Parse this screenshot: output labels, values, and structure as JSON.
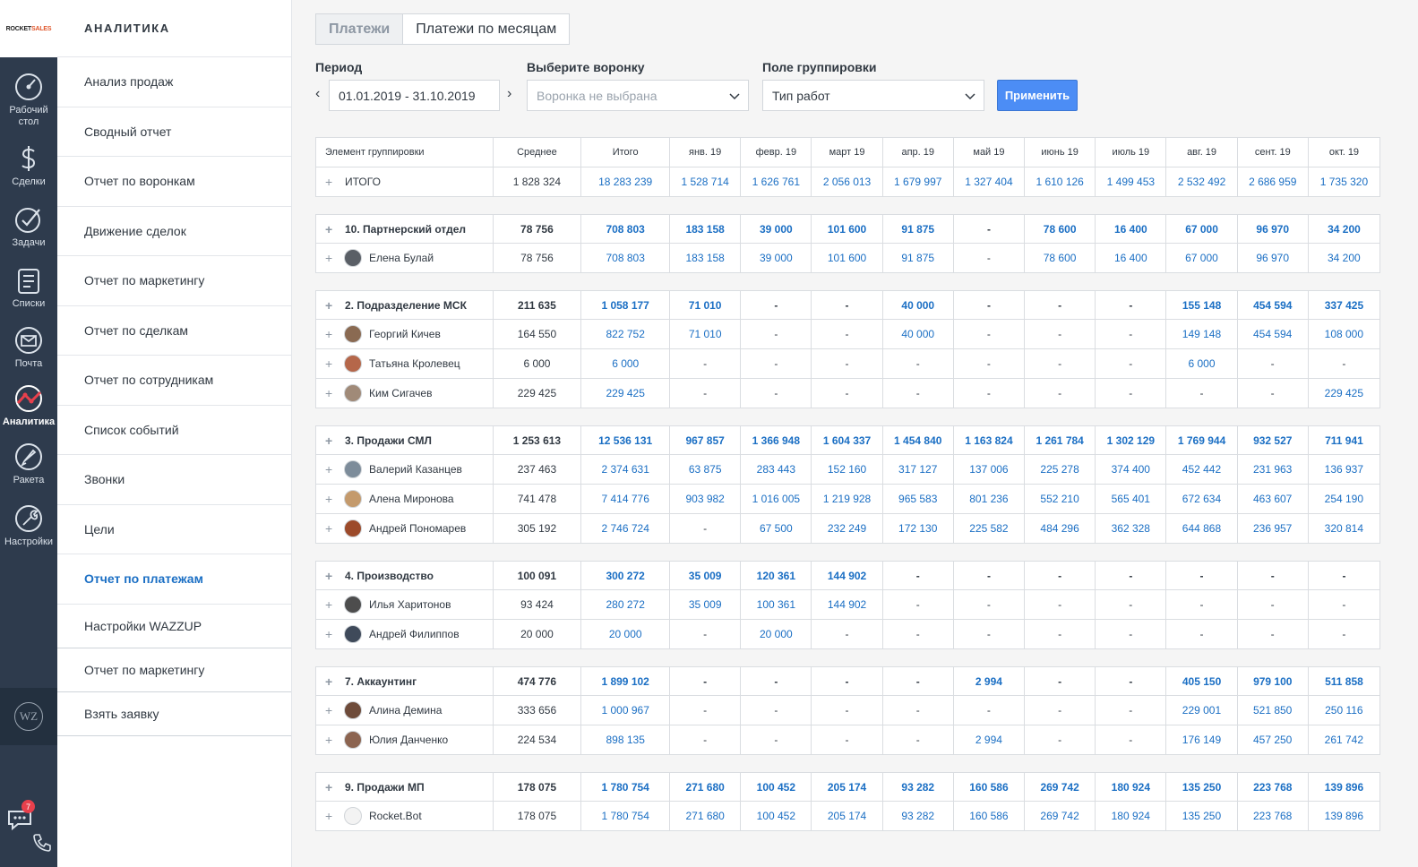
{
  "logo": {
    "part1": "ROCKET",
    "part2": "SALES"
  },
  "nav": [
    {
      "label": "Рабочий стол",
      "icon": "dashboard-icon"
    },
    {
      "label": "Сделки",
      "icon": "dollar-icon"
    },
    {
      "label": "Задачи",
      "icon": "check-icon"
    },
    {
      "label": "Списки",
      "icon": "list-icon"
    },
    {
      "label": "Почта",
      "icon": "mail-icon"
    },
    {
      "label": "Аналитика",
      "icon": "analytics-icon",
      "active": true
    },
    {
      "label": "Ракета",
      "icon": "rocket-icon"
    },
    {
      "label": "Настройки",
      "icon": "wrench-icon"
    }
  ],
  "wazzup_icon_text": "WZ",
  "chat_badge": "7",
  "submenu": {
    "title": "АНАЛИТИКА",
    "items": [
      "Анализ продаж",
      "Сводный отчет",
      "Отчет по воронкам",
      "Движение сделок",
      "Отчет по маркетингу",
      "Отчет по сделкам",
      "Отчет по сотрудникам",
      "Список событий",
      "Звонки",
      "Цели",
      "Отчет по платежам",
      "Настройки WAZZUP"
    ],
    "extra_items": [
      "Отчет по маркетингу",
      "Взять заявку"
    ]
  },
  "tabs": {
    "payments": "Платежи",
    "by_month": "Платежи по месяцам"
  },
  "filters": {
    "period_label": "Период",
    "period_value": "01.01.2019 - 31.10.2019",
    "prev_arrow": "‹",
    "next_arrow": "›",
    "funnel_label": "Выберите воронку",
    "funnel_placeholder": "Воронка не выбрана",
    "group_label": "Поле группировки",
    "group_value": "Тип работ",
    "apply": "Применить"
  },
  "table": {
    "headers": [
      "Элемент группировки",
      "Среднее",
      "Итого",
      "янв. 19",
      "февр. 19",
      "март 19",
      "апр. 19",
      "май 19",
      "июнь 19",
      "июль 19",
      "авг. 19",
      "сент. 19",
      "окт. 19"
    ],
    "total": {
      "name": "ИТОГО",
      "avg": "1 828 324",
      "values": [
        "18 283 239",
        "1 528 714",
        "1 626 761",
        "2 056 013",
        "1 679 997",
        "1 327 404",
        "1 610 126",
        "1 499 453",
        "2 532 492",
        "2 686 959",
        "1 735 320"
      ]
    },
    "groups": [
      {
        "name": "10. Партнерский отдел",
        "avg": "78 756",
        "values": [
          "708 803",
          "183 158",
          "39 000",
          "101 600",
          "91 875",
          "-",
          "78 600",
          "16 400",
          "67 000",
          "96 970",
          "34 200"
        ],
        "people": [
          {
            "name": "Елена Булай",
            "avg": "78 756",
            "values": [
              "708 803",
              "183 158",
              "39 000",
              "101 600",
              "91 875",
              "-",
              "78 600",
              "16 400",
              "67 000",
              "96 970",
              "34 200"
            ],
            "avatar": "#5a5f66"
          }
        ]
      },
      {
        "name": "2. Подразделение МСК",
        "avg": "211 635",
        "values": [
          "1 058 177",
          "71 010",
          "-",
          "-",
          "40 000",
          "-",
          "-",
          "-",
          "155 148",
          "454 594",
          "337 425"
        ],
        "people": [
          {
            "name": "Георгий Кичев",
            "avg": "164 550",
            "values": [
              "822 752",
              "71 010",
              "-",
              "-",
              "40 000",
              "-",
              "-",
              "-",
              "149 148",
              "454 594",
              "108 000"
            ],
            "avatar": "#8a6a52"
          },
          {
            "name": "Татьяна Кролевец",
            "avg": "6 000",
            "values": [
              "6 000",
              "-",
              "-",
              "-",
              "-",
              "-",
              "-",
              "-",
              "6 000",
              "-",
              "-"
            ],
            "avatar": "#b5674a"
          },
          {
            "name": "Ким Сигачев",
            "avg": "229 425",
            "values": [
              "229 425",
              "-",
              "-",
              "-",
              "-",
              "-",
              "-",
              "-",
              "-",
              "-",
              "229 425"
            ],
            "avatar": "#a08a78"
          }
        ]
      },
      {
        "name": "3. Продажи СМЛ",
        "avg": "1 253 613",
        "values": [
          "12 536 131",
          "967 857",
          "1 366 948",
          "1 604 337",
          "1 454 840",
          "1 163 824",
          "1 261 784",
          "1 302 129",
          "1 769 944",
          "932 527",
          "711 941"
        ],
        "people": [
          {
            "name": "Валерий Казанцев",
            "avg": "237 463",
            "values": [
              "2 374 631",
              "63 875",
              "283 443",
              "152 160",
              "317 127",
              "137 006",
              "225 278",
              "374 400",
              "452 442",
              "231 963",
              "136 937"
            ],
            "avatar": "#7d8c9a"
          },
          {
            "name": "Алена Миронова",
            "avg": "741 478",
            "values": [
              "7 414 776",
              "903 982",
              "1 016 005",
              "1 219 928",
              "965 583",
              "801 236",
              "552 210",
              "565 401",
              "672 634",
              "463 607",
              "254 190"
            ],
            "avatar": "#c49a6c"
          },
          {
            "name": "Андрей Пономарев",
            "avg": "305 192",
            "values": [
              "2 746 724",
              "-",
              "67 500",
              "232 249",
              "172 130",
              "225 582",
              "484 296",
              "362 328",
              "644 868",
              "236 957",
              "320 814"
            ],
            "avatar": "#9c4a2a"
          }
        ]
      },
      {
        "name": "4. Производство",
        "avg": "100 091",
        "values": [
          "300 272",
          "35 009",
          "120 361",
          "144 902",
          "-",
          "-",
          "-",
          "-",
          "-",
          "-",
          "-"
        ],
        "people": [
          {
            "name": "Илья Харитонов",
            "avg": "93 424",
            "values": [
              "280 272",
              "35 009",
              "100 361",
              "144 902",
              "-",
              "-",
              "-",
              "-",
              "-",
              "-",
              "-"
            ],
            "avatar": "#4d4d4d"
          },
          {
            "name": "Андрей Филиппов",
            "avg": "20 000",
            "values": [
              "20 000",
              "-",
              "20 000",
              "-",
              "-",
              "-",
              "-",
              "-",
              "-",
              "-",
              "-"
            ],
            "avatar": "#3f4a5a"
          }
        ]
      },
      {
        "name": "7. Аккаунтинг",
        "avg": "474 776",
        "values": [
          "1 899 102",
          "-",
          "-",
          "-",
          "-",
          "2 994",
          "-",
          "-",
          "405 150",
          "979 100",
          "511 858"
        ],
        "people": [
          {
            "name": "Алина Демина",
            "avg": "333 656",
            "values": [
              "1 000 967",
              "-",
              "-",
              "-",
              "-",
              "-",
              "-",
              "-",
              "229 001",
              "521 850",
              "250 116"
            ],
            "avatar": "#6e4b3a"
          },
          {
            "name": "Юлия Данченко",
            "avg": "224 534",
            "values": [
              "898 135",
              "-",
              "-",
              "-",
              "-",
              "2 994",
              "-",
              "-",
              "176 149",
              "457 250",
              "261 742"
            ],
            "avatar": "#8c6450"
          }
        ]
      },
      {
        "name": "9. Продажи МП",
        "avg": "178 075",
        "values": [
          "1 780 754",
          "271 680",
          "100 452",
          "205 174",
          "93 282",
          "160 586",
          "269 742",
          "180 924",
          "135 250",
          "223 768",
          "139 896"
        ],
        "people": [
          {
            "name": "Rocket.Bot",
            "avg": "178 075",
            "values": [
              "1 780 754",
              "271 680",
              "100 452",
              "205 174",
              "93 282",
              "160 586",
              "269 742",
              "180 924",
              "135 250",
              "223 768",
              "139 896"
            ],
            "avatar": "#f3f3f3"
          }
        ]
      }
    ]
  }
}
